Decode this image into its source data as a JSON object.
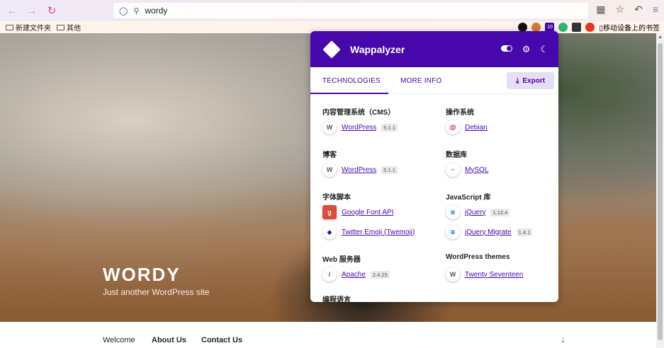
{
  "browser": {
    "url": "wordy",
    "bookmarks": [
      "新建文件夹",
      "其他"
    ],
    "mobile_bookmarks": "移动设备上的书签",
    "extension_badge": "10"
  },
  "site": {
    "title": "WORDY",
    "tagline": "Just another WordPress site",
    "nav": [
      "Welcome",
      "About Us",
      "Contact Us"
    ],
    "scroll_icon": "↓"
  },
  "wappalyzer": {
    "brand": "Wappalyzer",
    "tabs": [
      "TECHNOLOGIES",
      "MORE INFO"
    ],
    "export_label": "Export",
    "categories": [
      {
        "name": "内容管理系统（CMS）",
        "items": [
          {
            "name": "WordPress",
            "version": "5.1.1",
            "icon": "W"
          }
        ]
      },
      {
        "name": "操作系统",
        "items": [
          {
            "name": "Debian",
            "version": "",
            "icon": "@"
          }
        ]
      },
      {
        "name": "博客",
        "items": [
          {
            "name": "WordPress",
            "version": "5.1.1",
            "icon": "W"
          }
        ]
      },
      {
        "name": "数据库",
        "items": [
          {
            "name": "MySQL",
            "version": "",
            "icon": "~"
          }
        ]
      },
      {
        "name": "字体脚本",
        "items": [
          {
            "name": "Google Font API",
            "version": "",
            "icon": "g"
          },
          {
            "name": "Twitter Emoji (Twemoji)",
            "version": "",
            "icon": "◆"
          }
        ]
      },
      {
        "name": "JavaScript 库",
        "items": [
          {
            "name": "jQuery",
            "version": "1.12.4",
            "icon": "≋"
          },
          {
            "name": "jQuery Migrate",
            "version": "1.4.1",
            "icon": "≋"
          }
        ]
      },
      {
        "name": "Web 服务器",
        "items": [
          {
            "name": "Apache",
            "version": "2.4.25",
            "icon": "/"
          }
        ]
      },
      {
        "name": "WordPress themes",
        "items": [
          {
            "name": "Twenty Seventeen",
            "version": "",
            "icon": "W"
          }
        ]
      },
      {
        "name": "编程语言",
        "items": []
      }
    ]
  }
}
